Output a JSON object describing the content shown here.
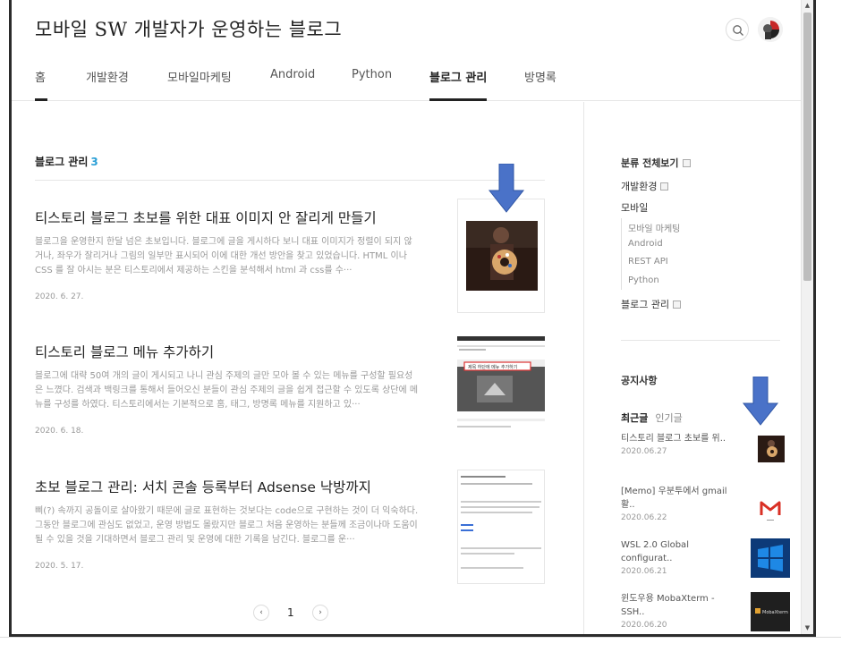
{
  "header": {
    "blog_title": "모바일 SW 개발자가 운영하는 블로그",
    "search_icon": "search-icon"
  },
  "nav": {
    "items": [
      {
        "label": "홈",
        "active": false,
        "underlined": true
      },
      {
        "label": "개발환경"
      },
      {
        "label": "모바일마케팅"
      },
      {
        "label": "Android"
      },
      {
        "label": "Python"
      },
      {
        "label": "블로그 관리",
        "active": true
      },
      {
        "label": "방명록"
      }
    ]
  },
  "main": {
    "category_name": "블로그 관리",
    "category_count": "3",
    "posts": [
      {
        "title": "티스토리 블로그 초보를 위한 대표 이미지 안 잘리게 만들기",
        "excerpt": "블로그을 운영한지 한달 넘은 초보입니다. 블로그에 글을 게시하다 보니 대표 이미지가 정렬이 되지 않거나, 좌우가 잘리거나 그림의 일부만 표시되어 이에 대한 개선 방안을 찾고 있었습니다. HTML 이나 CSS 를 잘 아시는 분은 티스토리에서 제공하는 스킨을 분석해서 html 과 css를 수···",
        "date": "2020. 6. 27."
      },
      {
        "title": "티스토리 블로그 메뉴 추가하기",
        "excerpt": "블로그에 대략 50여 개의 글이 게시되고 나니 관심 주제의 글만 모아 볼 수 있는 메뉴를 구성할 필요성은 느꼈다. 검색과 백링크를 통해서 들어오신 분들이 관심 주제의 글을 쉽게 접근할 수 있도록 상단에 메뉴를 구성를 하였다. 티스토리에서는 기본적으로 홈, 태그, 방명록 메뉴를 지원하고 있···",
        "date": "2020. 6. 18.",
        "thumb_caption": "제목 하단에 메뉴 추가하기"
      },
      {
        "title": "초보 블로그 관리: 서치 콘솔 등록부터 Adsense 낙방까지",
        "excerpt": "삐(?) 속까지 공돌이로 살아왔기 때문에 글로 표현하는 것보다는 code으로 구현하는 것이 더 익숙하다. 그동안 블로그에 관심도 없었고, 운영 방법도 몰랐지만 블로그 처음 운영하는 분들께 조금이나마 도움이 될 수 있을 것을 기대하면서 블로그 관리 및 운영에 대한 기록을 남긴다. 블로그를 운···",
        "date": "2020. 5. 17."
      }
    ],
    "pager": {
      "prev": "‹",
      "current": "1",
      "next": "›"
    }
  },
  "sidebar": {
    "categories_all": "분류 전체보기",
    "categories": [
      {
        "label": "개발환경",
        "level": 1,
        "new": true
      },
      {
        "label": "모바일",
        "level": 1,
        "new": false
      },
      {
        "label": "모바일 마케팅",
        "level": 2
      },
      {
        "label": "Android",
        "level": 2
      },
      {
        "label": "REST API",
        "level": 2
      },
      {
        "label": "Python",
        "level": 2
      },
      {
        "label": "블로그 관리",
        "level": 1,
        "new": true
      }
    ],
    "notice_label": "공지사항",
    "tab_recent": "최근글",
    "tab_popular": "인기글",
    "recent_posts": [
      {
        "title": "티스토리 블로그 초보를 위..",
        "date": "2020.06.27"
      },
      {
        "title": "[Memo] 우분투에서 gmail 활..",
        "date": "2020.06.22"
      },
      {
        "title": "WSL 2.0 Global configurat..",
        "date": "2020.06.21"
      },
      {
        "title": "윈도우용 MobaXterm - SSH..",
        "date": "2020.06.20",
        "thumb_text": "MobaXterm"
      }
    ]
  },
  "colors": {
    "accent_count": "#2a9fd6",
    "annotation_arrow": "#4a72c8",
    "gmail_red": "#d93025",
    "windows_blue": "#1e88e5"
  }
}
